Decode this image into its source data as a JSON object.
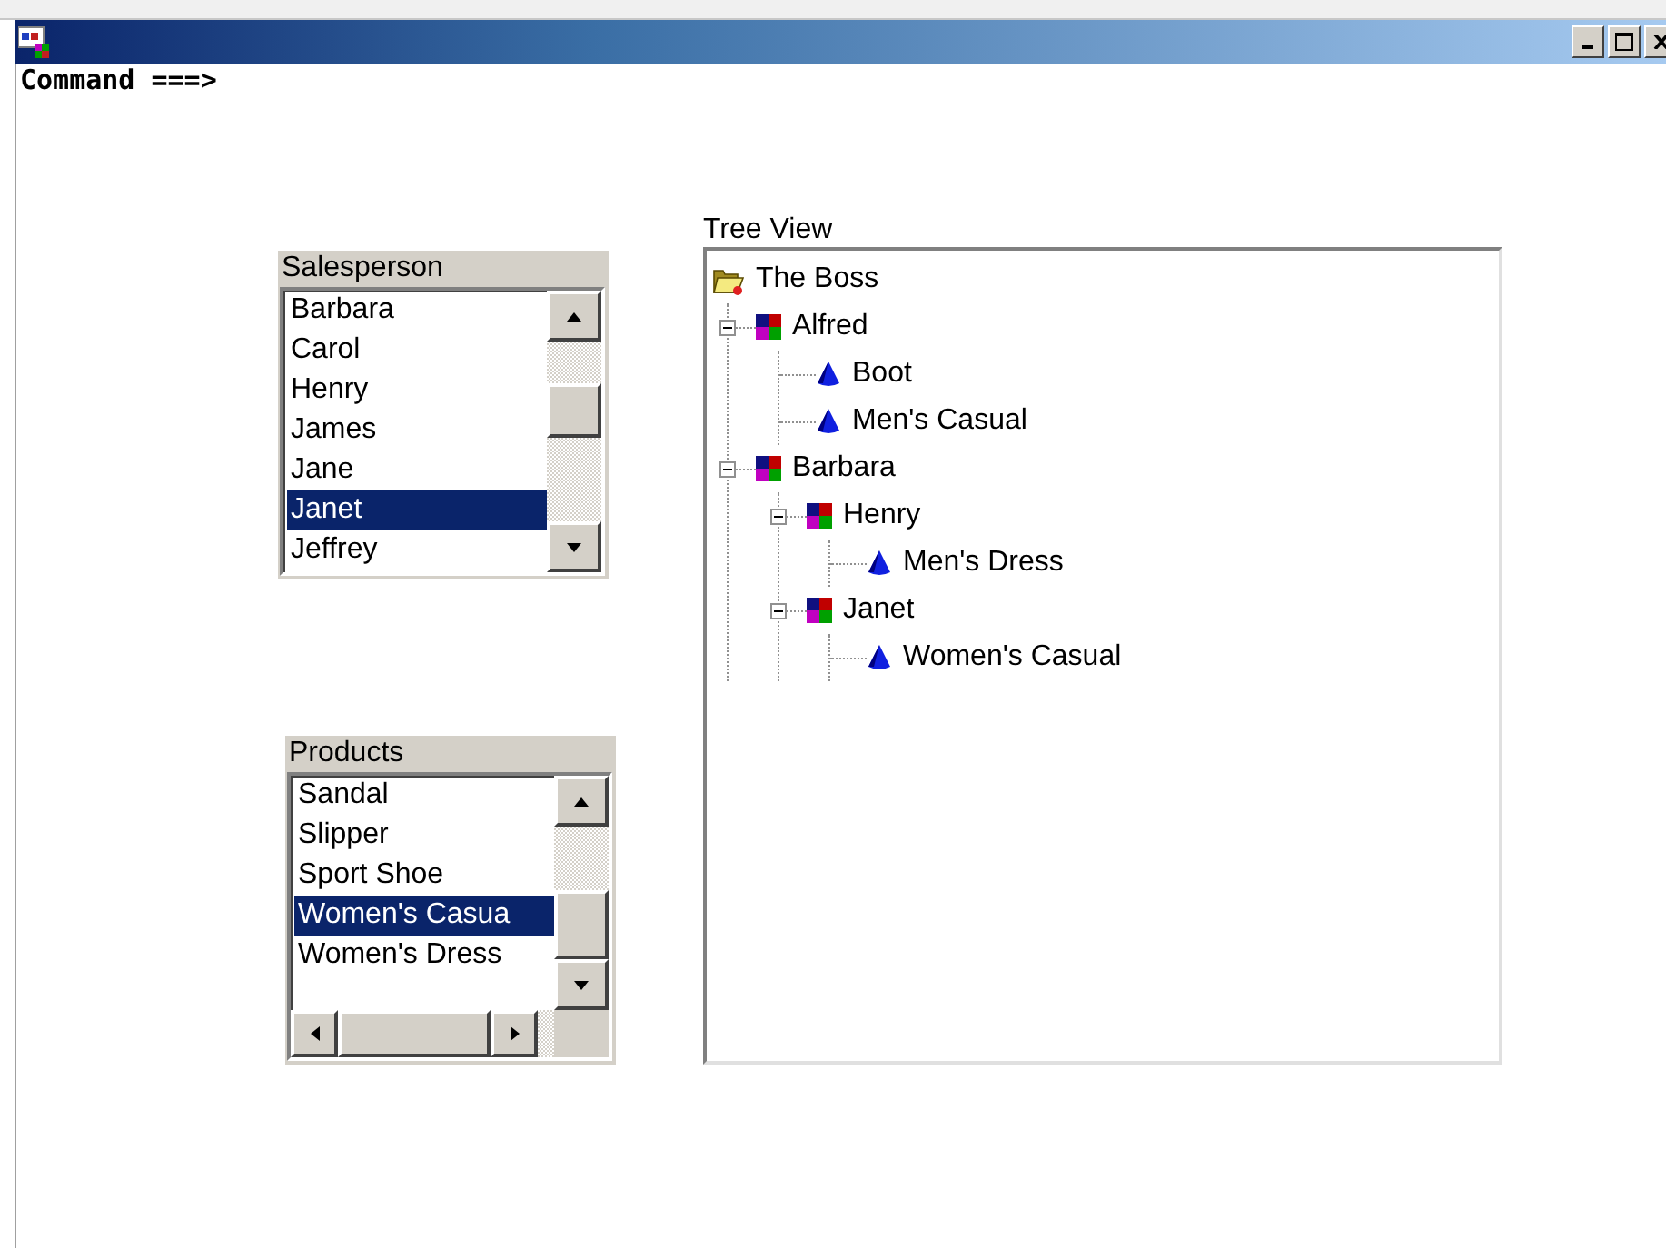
{
  "command_line": {
    "prompt": "Command ===>"
  },
  "salesperson": {
    "label": "Salesperson",
    "items": [
      {
        "text": "Barbara",
        "selected": false
      },
      {
        "text": "Carol",
        "selected": false
      },
      {
        "text": "Henry",
        "selected": false
      },
      {
        "text": "James",
        "selected": false
      },
      {
        "text": "Jane",
        "selected": false
      },
      {
        "text": "Janet",
        "selected": true
      },
      {
        "text": "Jeffrey",
        "selected": false
      }
    ]
  },
  "products": {
    "label": "Products",
    "items": [
      {
        "text": "Sandal",
        "selected": false
      },
      {
        "text": "Slipper",
        "selected": false
      },
      {
        "text": "Sport Shoe",
        "selected": false
      },
      {
        "text": "Women's Casua",
        "selected": true
      },
      {
        "text": "Women's Dress",
        "selected": false
      }
    ]
  },
  "tree_view": {
    "label": "Tree View",
    "root": {
      "label": "The Boss",
      "kind": "folder",
      "expanded": true,
      "children": [
        {
          "label": "Alfred",
          "kind": "person",
          "expanded": true,
          "children": [
            {
              "label": "Boot",
              "kind": "product"
            },
            {
              "label": "Men's Casual",
              "kind": "product"
            }
          ]
        },
        {
          "label": "Barbara",
          "kind": "person",
          "expanded": true,
          "children": [
            {
              "label": "Henry",
              "kind": "person",
              "expanded": true,
              "children": [
                {
                  "label": "Men's Dress",
                  "kind": "product"
                }
              ]
            },
            {
              "label": "Janet",
              "kind": "person",
              "expanded": true,
              "children": [
                {
                  "label": "Women's Casual",
                  "kind": "product"
                }
              ]
            }
          ]
        }
      ]
    }
  }
}
